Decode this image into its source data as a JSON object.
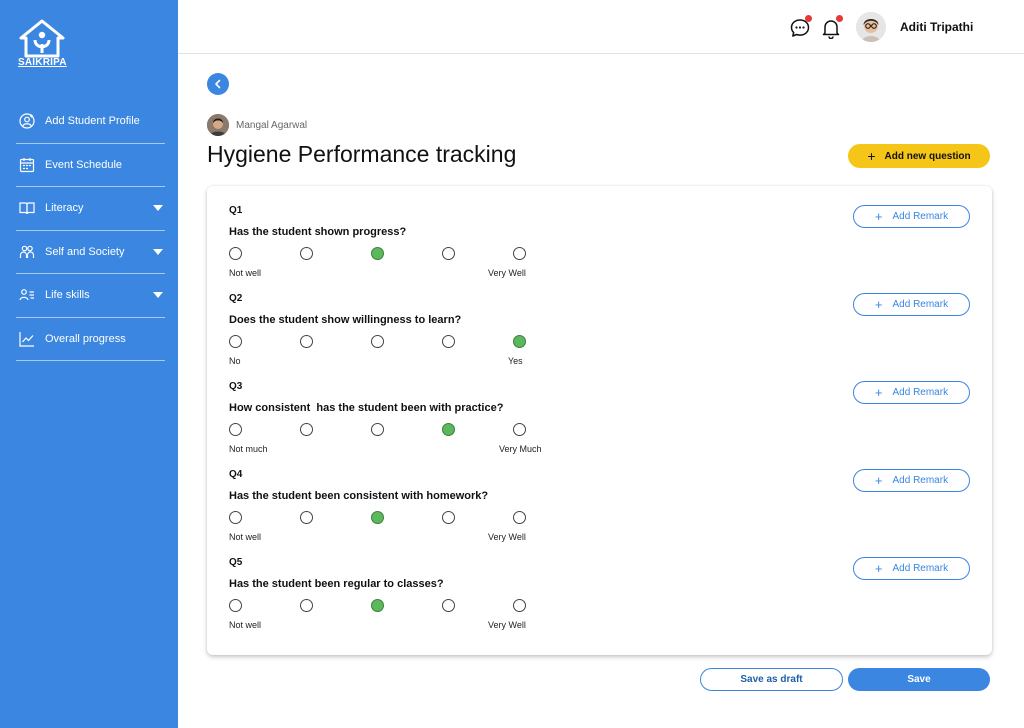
{
  "brand": {
    "name": "SAIKRIPA",
    "color": "#3a86e0"
  },
  "sidebar": {
    "items": [
      {
        "label": "Add Student Profile",
        "icon": "user-add-icon",
        "has_caret": false
      },
      {
        "label": "Event Schedule",
        "icon": "calendar-icon",
        "has_caret": false
      },
      {
        "label": "Literacy",
        "icon": "book-icon",
        "has_caret": true
      },
      {
        "label": "Self and Society",
        "icon": "people-icon",
        "has_caret": true
      },
      {
        "label": "Life skills",
        "icon": "user-list-icon",
        "has_caret": true
      },
      {
        "label": "Overall progress",
        "icon": "chart-line-icon",
        "has_caret": false
      }
    ]
  },
  "header": {
    "user_name": "Aditi Tripathi",
    "icons": [
      "chat-icon",
      "bell-icon"
    ],
    "notification_dot_color": "#e53935"
  },
  "page": {
    "student_name": "Mangal Agarwal",
    "title": "Hygiene Performance tracking",
    "add_question_label": "Add new question",
    "add_question_color": "#f5c518"
  },
  "questions": [
    {
      "num": "Q1",
      "text": "Has the student shown progress?",
      "low": "Not well",
      "high": "Very Well",
      "selected": 3,
      "remark": "Add Remark"
    },
    {
      "num": "Q2",
      "text": "Does the student show willingness to learn?",
      "low": "No",
      "high": "Yes",
      "selected": 5,
      "remark": "Add Remark"
    },
    {
      "num": "Q3",
      "text": "How consistent  has the student been with practice?",
      "low": "Not much",
      "high": "Very Much",
      "selected": 4,
      "remark": "Add Remark"
    },
    {
      "num": "Q4",
      "text": "Has the student been consistent with homework?",
      "low": "Not well",
      "high": "Very Well",
      "selected": 3,
      "remark": "Add Remark"
    },
    {
      "num": "Q5",
      "text": "Has the student been regular to classes?",
      "low": "Not well",
      "high": "Very Well",
      "selected": 3,
      "remark": "Add Remark"
    }
  ],
  "rating_scale": {
    "options": 5,
    "selected_color": "#5cb85c"
  },
  "footer": {
    "draft_label": "Save as draft",
    "save_label": "Save"
  }
}
